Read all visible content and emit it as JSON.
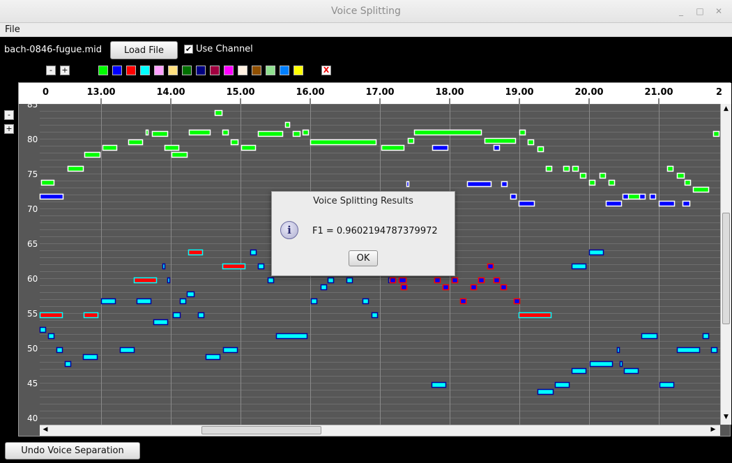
{
  "window": {
    "title": "Voice Splitting"
  },
  "menubar": {
    "file": "File"
  },
  "toolbar": {
    "filename": "bach-0846-fugue.mid",
    "load_button": "Load File",
    "use_channel_label": "Use Channel",
    "use_channel_checked": true,
    "zoom_minus": "-",
    "zoom_plus": "+"
  },
  "palette": {
    "colors": [
      "#00ff00",
      "#0000ff",
      "#ff0000",
      "#00ffff",
      "#ffa0ff",
      "#ffe080",
      "#007000",
      "#000080",
      "#a00040",
      "#ff00ff",
      "#fff0e0",
      "#905000",
      "#90e090",
      "#0080ff",
      "#ffff00"
    ],
    "remove_label": "X"
  },
  "piano_roll": {
    "time_labels": [
      "0",
      "13.00",
      "14.00",
      "15.00",
      "16.00",
      "17.00",
      "18.00",
      "19.00",
      "20.00",
      "21.00",
      "2"
    ],
    "pitch_labels": [
      "85",
      "80",
      "75",
      "70",
      "65",
      "60",
      "55",
      "50",
      "45",
      "40"
    ],
    "vertical_zoom_minus": "-",
    "vertical_zoom_plus": "+"
  },
  "dialog": {
    "title": "Voice Splitting Results",
    "message": "F1 = 0.9602194787379972",
    "ok_button": "OK"
  },
  "bottom": {
    "undo_button": "Undo Voice Separation"
  },
  "voice_colors": {
    "green": "#00ff00",
    "blue": "#0000ff",
    "red": "#ff0000",
    "cyan": "#00ffff"
  }
}
